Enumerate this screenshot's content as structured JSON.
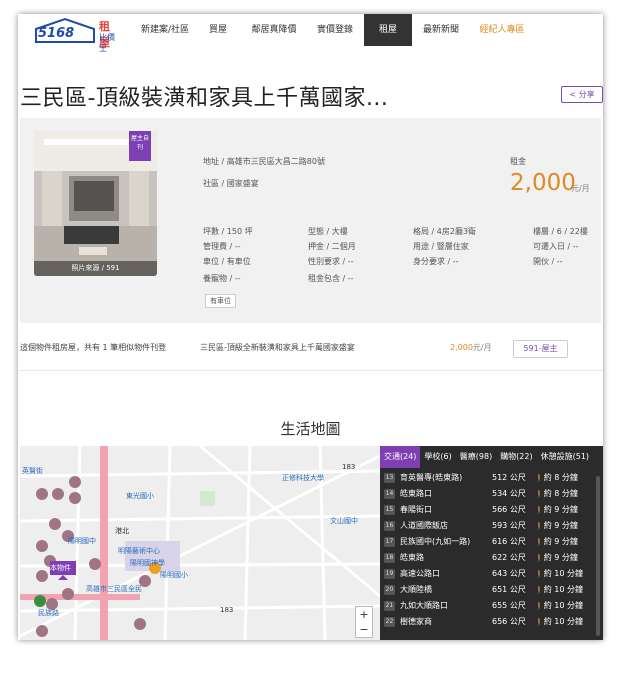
{
  "logo": {
    "number": "5168",
    "line1": "租屋",
    "line2": "比價王"
  },
  "nav": [
    {
      "label": "新建案/社區",
      "width": 58,
      "style": ""
    },
    {
      "label": "買屋",
      "width": 48,
      "style": ""
    },
    {
      "label": "鄰居真降價",
      "width": 64,
      "style": ""
    },
    {
      "label": "實價登錄",
      "width": 58,
      "style": ""
    },
    {
      "label": "租屋",
      "width": 48,
      "style": "active"
    },
    {
      "label": "最新新聞",
      "width": 58,
      "style": ""
    },
    {
      "label": "經紀人專區",
      "width": 64,
      "style": "orange"
    }
  ],
  "title": "三民區-頂級裝潢和家具上千萬國家...",
  "share_label": "分享",
  "photo": {
    "badge": "屋主自刊",
    "caption": "照片來源 / 591"
  },
  "address": "地址 / 高雄市三民區大昌二路80號",
  "community": "社區 / 國家盛宴",
  "rent": {
    "label": "租金",
    "price": "2,000",
    "unit": "元/月"
  },
  "details": [
    [
      "坪數 / 150 坪",
      "型態 / 大樓",
      "格局 / 4房2廳3衛",
      "樓層 / 6 / 22樓"
    ],
    [
      "管理費 / --",
      "押金 / 二個月",
      "用途 / 豎層住家",
      "可遷入日 / --"
    ],
    [
      "車位 / 有車位",
      "性別要求 / --",
      "身分要求 / --",
      "開伙 / --"
    ],
    [
      "養寵物 / --",
      "租金包含 / --",
      "",
      ""
    ]
  ],
  "feature_tag": "有車位",
  "similar": {
    "text": "這個物件租房屋，共有 1 筆相似物件刊登",
    "listing": "三民區-頂級全新裝潢和家具上千萬國家盛宴",
    "price": "2,000",
    "unit": "元/月",
    "source": "591-屋主"
  },
  "section_title": "生活地圖",
  "map": {
    "labels": [
      "英賢街",
      "正修科技大學",
      "183",
      "東光國小",
      "文山國中",
      "港北",
      "陽明國中",
      "明陽藝術中心",
      "陽明國小",
      "本物件",
      "陽明國神學",
      "高雄市三民區全民",
      "民族路",
      "183"
    ],
    "zoom_in": "+",
    "zoom_out": "−"
  },
  "transit": {
    "tabs": [
      "交通(24)",
      "學校(6)",
      "醫療(98)",
      "購物(22)",
      "休憩設施(51)"
    ],
    "rows": [
      {
        "n": "13",
        "name": "育英醫專(皓東路)",
        "dist": "512 公尺",
        "time": "約 8 分鐘"
      },
      {
        "n": "14",
        "name": "皓東路口",
        "dist": "534 公尺",
        "time": "約 8 分鐘"
      },
      {
        "n": "15",
        "name": "春陽街口",
        "dist": "566 公尺",
        "time": "約 9 分鐘"
      },
      {
        "n": "16",
        "name": "人道國際飯店",
        "dist": "593 公尺",
        "time": "約 9 分鐘"
      },
      {
        "n": "17",
        "name": "民族國中(九如一路)",
        "dist": "616 公尺",
        "time": "約 9 分鐘"
      },
      {
        "n": "18",
        "name": "皓東路",
        "dist": "622 公尺",
        "time": "約 9 分鐘"
      },
      {
        "n": "19",
        "name": "高速公路口",
        "dist": "643 公尺",
        "time": "約 10 分鐘"
      },
      {
        "n": "20",
        "name": "大順陸橋",
        "dist": "651 公尺",
        "time": "約 10 分鐘"
      },
      {
        "n": "21",
        "name": "九如大順路口",
        "dist": "655 公尺",
        "time": "約 10 分鐘"
      },
      {
        "n": "22",
        "name": "樹德家商",
        "dist": "656 公尺",
        "time": "約 10 分鐘"
      }
    ]
  },
  "colors": {
    "accent": "#7d3fb3",
    "price": "#e08a1e",
    "nav_active": "#333333"
  }
}
